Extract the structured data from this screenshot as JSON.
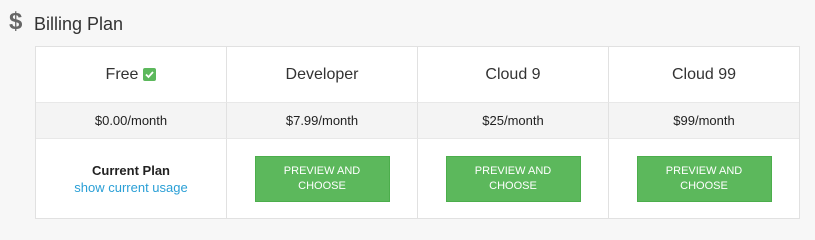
{
  "section": {
    "icon": "dollar-icon",
    "title": "Billing Plan"
  },
  "plans": [
    {
      "name": "Free",
      "price": "$0.00/month",
      "current": true,
      "current_label": "Current Plan",
      "usage_link": "show current usage"
    },
    {
      "name": "Developer",
      "price": "$7.99/month",
      "button_label": "PREVIEW AND CHOOSE"
    },
    {
      "name": "Cloud 9",
      "price": "$25/month",
      "button_label": "PREVIEW AND CHOOSE"
    },
    {
      "name": "Cloud 99",
      "price": "$99/month",
      "button_label": "PREVIEW AND CHOOSE"
    }
  ],
  "colors": {
    "accent_green": "#5cb85c",
    "link_blue": "#2a9fd6"
  }
}
